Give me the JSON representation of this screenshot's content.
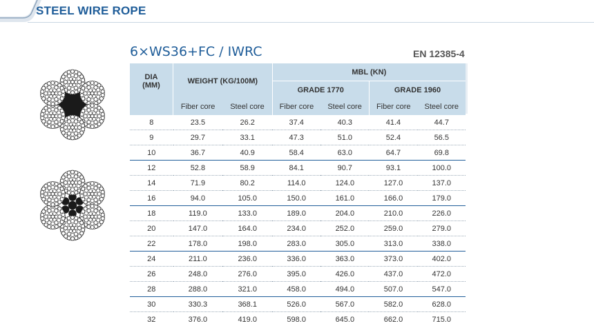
{
  "header": {
    "title": "STEEL WIRE ROPE"
  },
  "product": {
    "title": "6×WS36+FC / IWRC",
    "standard": "EN 12385-4"
  },
  "table": {
    "dia_label_1": "DIA",
    "dia_label_2": "(MM)",
    "weight_label": "WEIGHT (KG/100M)",
    "mbl_label": "MBL (KN)",
    "grade_1770": "GRADE 1770",
    "grade_1960": "GRADE 1960",
    "sub": [
      "Fiber core",
      "Steel core",
      "Fiber core",
      "Steel core",
      "Fiber core",
      "Steel core"
    ],
    "rows": [
      [
        "8",
        "23.5",
        "26.2",
        "37.4",
        "40.3",
        "41.4",
        "44.7"
      ],
      [
        "9",
        "29.7",
        "33.1",
        "47.3",
        "51.0",
        "52.4",
        "56.5"
      ],
      [
        "10",
        "36.7",
        "40.9",
        "58.4",
        "63.0",
        "64.7",
        "69.8"
      ],
      [
        "12",
        "52.8",
        "58.9",
        "84.1",
        "90.7",
        "93.1",
        "100.0"
      ],
      [
        "14",
        "71.9",
        "80.2",
        "114.0",
        "124.0",
        "127.0",
        "137.0"
      ],
      [
        "16",
        "94.0",
        "105.0",
        "150.0",
        "161.0",
        "166.0",
        "179.0"
      ],
      [
        "18",
        "119.0",
        "133.0",
        "189.0",
        "204.0",
        "210.0",
        "226.0"
      ],
      [
        "20",
        "147.0",
        "164.0",
        "234.0",
        "252.0",
        "259.0",
        "279.0"
      ],
      [
        "22",
        "178.0",
        "198.0",
        "283.0",
        "305.0",
        "313.0",
        "338.0"
      ],
      [
        "24",
        "211.0",
        "236.0",
        "336.0",
        "363.0",
        "373.0",
        "402.0"
      ],
      [
        "26",
        "248.0",
        "276.0",
        "395.0",
        "426.0",
        "437.0",
        "472.0"
      ],
      [
        "28",
        "288.0",
        "321.0",
        "458.0",
        "494.0",
        "507.0",
        "547.0"
      ],
      [
        "30",
        "330.3",
        "368.1",
        "526.0",
        "567.0",
        "582.0",
        "628.0"
      ],
      [
        "32",
        "376.0",
        "419.0",
        "598.0",
        "645.0",
        "662.0",
        "715.0"
      ]
    ]
  },
  "colors": {
    "brand": "#1f5d99",
    "header_bg": "#c8dcea",
    "group_rule": "#1f5d99"
  }
}
